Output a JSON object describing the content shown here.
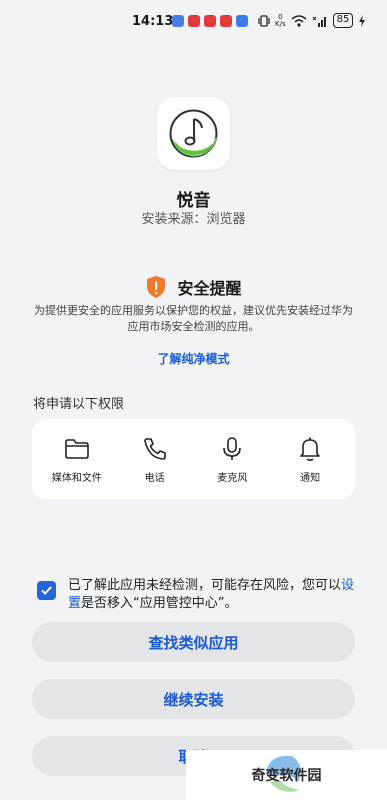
{
  "status_bar": {
    "time": "14:13",
    "net_unit": "K/s",
    "net_value": "0",
    "battery": "85",
    "app_colors": [
      "#4a7de8",
      "#e23b3b",
      "#e23b3b",
      "#e23b3b",
      "#3a7de8"
    ]
  },
  "app": {
    "name": "悦音",
    "source": "安装来源：浏览器",
    "icon_name": "music-note-icon"
  },
  "warning": {
    "title": "安全提醒",
    "body": "为提供更安全的应用服务以保护您的权益，建议优先安装经过华为应用市场安全检测的应用。",
    "learn_more": "了解纯净模式",
    "icon_color": "#f07a2a"
  },
  "permissions": {
    "heading": "将申请以下权限",
    "items": [
      {
        "label": "媒体和文件",
        "icon": "folder-icon"
      },
      {
        "label": "电话",
        "icon": "phone-icon"
      },
      {
        "label": "麦克风",
        "icon": "microphone-icon"
      },
      {
        "label": "通知",
        "icon": "bell-icon"
      }
    ]
  },
  "consent": {
    "checked": true,
    "text_before": "已了解此应用未经检测，可能存在风险，您可以",
    "link": "设置",
    "text_after": "是否移入“应用管控中心”。"
  },
  "buttons": {
    "find_similar": "查找类似应用",
    "continue_install": "继续安装",
    "cancel": "取消"
  },
  "watermark": {
    "text": "奇变软件园"
  },
  "colors": {
    "accent": "#1a5bd8",
    "background": "#f1f3f5",
    "button_bg": "#e3e5e8",
    "checkbox": "#2266d8"
  }
}
